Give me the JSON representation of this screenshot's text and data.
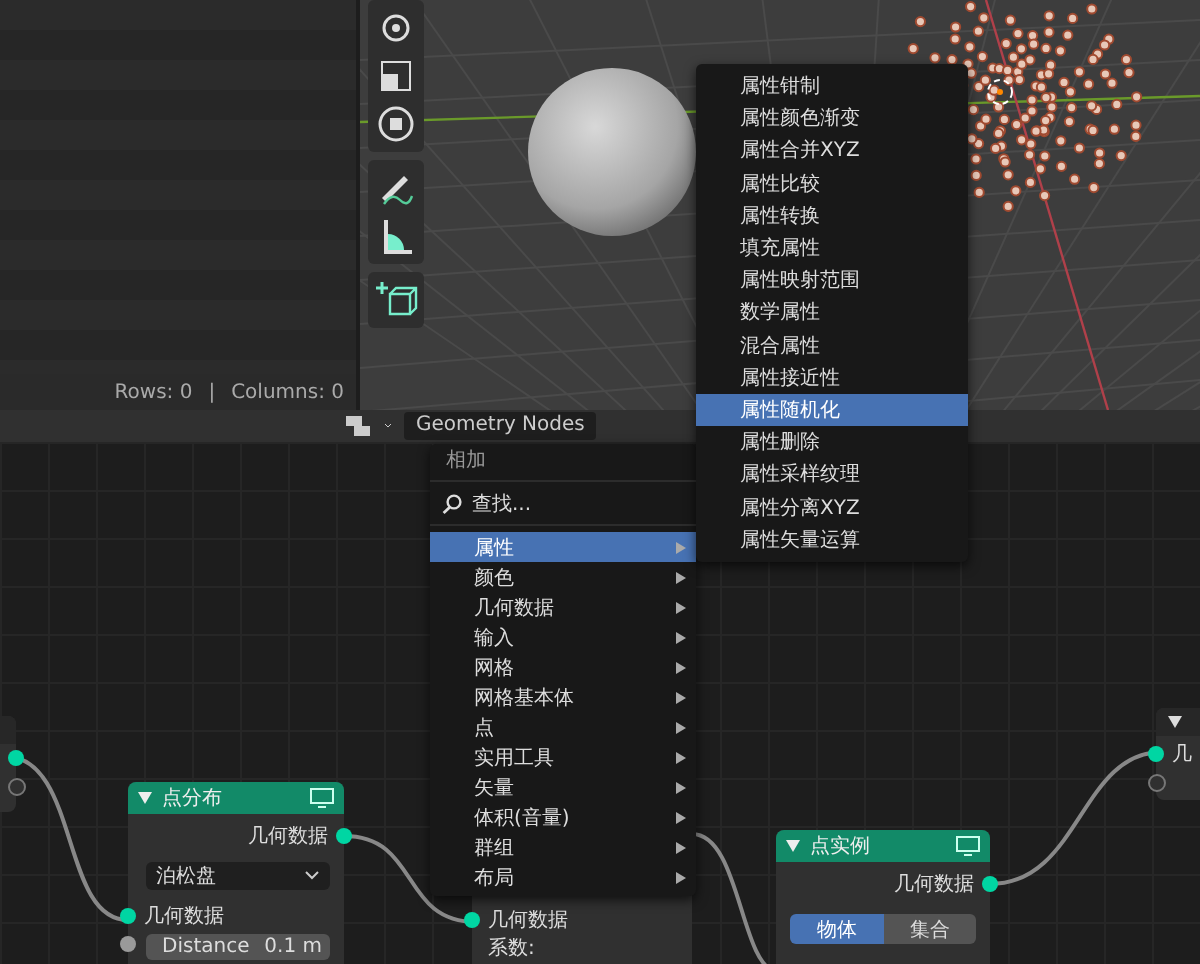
{
  "spreadsheet_footer": {
    "rows": "Rows: 0",
    "separator": "|",
    "columns": "Columns: 0"
  },
  "node_editor_header": {
    "title": "Geometry Nodes"
  },
  "add_menu": {
    "title": "相加",
    "search": "查找...",
    "items": [
      {
        "label": "属性",
        "selected": true
      },
      {
        "label": "颜色",
        "selected": false
      },
      {
        "label": "几何数据",
        "selected": false
      },
      {
        "label": "输入",
        "selected": false
      },
      {
        "label": "网格",
        "selected": false
      },
      {
        "label": "网格基本体",
        "selected": false
      },
      {
        "label": "点",
        "selected": false
      },
      {
        "label": "实用工具",
        "selected": false
      },
      {
        "label": "矢量",
        "selected": false
      },
      {
        "label": "体积(音量)",
        "selected": false
      },
      {
        "label": "群组",
        "selected": false
      },
      {
        "label": "布局",
        "selected": false
      }
    ]
  },
  "attribute_submenu": {
    "items": [
      {
        "label": "属性钳制",
        "selected": false
      },
      {
        "label": "属性颜色渐变",
        "selected": false
      },
      {
        "label": "属性合并XYZ",
        "selected": false
      },
      {
        "label": "属性比较",
        "selected": false
      },
      {
        "label": "属性转换",
        "selected": false
      },
      {
        "label": "填充属性",
        "selected": false
      },
      {
        "label": "属性映射范围",
        "selected": false
      },
      {
        "label": "数学属性",
        "selected": false
      },
      {
        "label": "混合属性",
        "selected": false
      },
      {
        "label": "属性接近性",
        "selected": false
      },
      {
        "label": "属性随机化",
        "selected": true
      },
      {
        "label": "属性删除",
        "selected": false
      },
      {
        "label": "属性采样纹理",
        "selected": false
      },
      {
        "label": "属性分离XYZ",
        "selected": false
      },
      {
        "label": "属性矢量运算",
        "selected": false
      }
    ]
  },
  "point_distribute_node": {
    "title": "点分布",
    "output": "几何数据",
    "mode": "泊松盘",
    "input": "几何数据",
    "distance": {
      "label": "Distance",
      "value": "0.1 m"
    }
  },
  "hidden_node": {
    "input": "几何数据",
    "factor_label": "系数:"
  },
  "point_instance_node": {
    "title": "点实例",
    "output": "几何数据",
    "options": [
      {
        "label": "物体",
        "selected": true
      },
      {
        "label": "集合",
        "selected": false
      }
    ]
  },
  "output_node": {
    "input": "几"
  }
}
